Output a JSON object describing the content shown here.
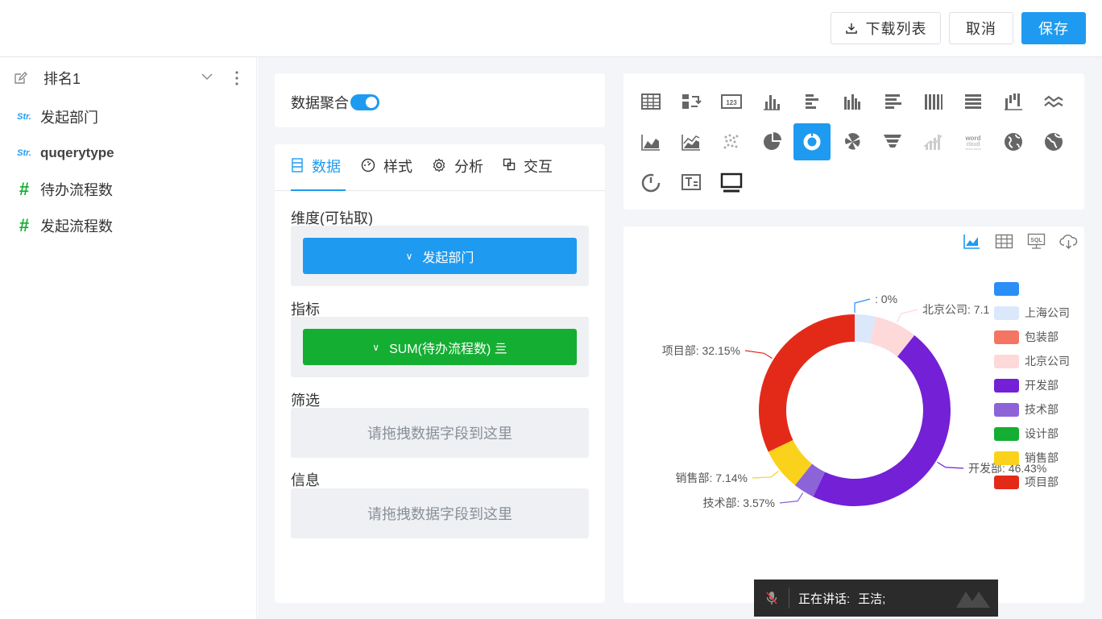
{
  "toolbar": {
    "download_label": "下载列表",
    "cancel_label": "取消",
    "save_label": "保存"
  },
  "sidebar": {
    "title": "排名1",
    "fields": [
      {
        "type": "Str.",
        "label": "发起部门"
      },
      {
        "type": "Str.",
        "label": "quqerytype"
      },
      {
        "type": "#",
        "label": "待办流程数"
      },
      {
        "type": "#",
        "label": "发起流程数"
      }
    ]
  },
  "aggregation": {
    "label": "数据聚合",
    "enabled": true
  },
  "tabs": [
    {
      "label": "数据",
      "icon": "data-icon"
    },
    {
      "label": "样式",
      "icon": "style-icon"
    },
    {
      "label": "分析",
      "icon": "gear-icon"
    },
    {
      "label": "交互",
      "icon": "interaction-icon"
    }
  ],
  "config": {
    "dimension_title": "维度(可钻取)",
    "dimension_value": "发起部门",
    "metric_title": "指标",
    "metric_value": "SUM(待办流程数) 亖",
    "filter_title": "筛选",
    "filter_placeholder": "请拖拽数据字段到这里",
    "info_title": "信息",
    "info_placeholder": "请拖拽数据字段到这里"
  },
  "chart_types": [
    "table",
    "pivot-table",
    "number-card",
    "column",
    "bar",
    "grouped-column",
    "stacked-bar",
    "percent-column",
    "percent-bar",
    "waterfall",
    "dual-line",
    "area",
    "stacked-area",
    "scatter",
    "pie",
    "donut",
    "rose",
    "funnel",
    "gradient-bar",
    "word-cloud",
    "map",
    "3d-map",
    "gauge",
    "text",
    "screen"
  ],
  "active_chart_type": "donut",
  "chart_tools": [
    "chart-icon",
    "table-icon",
    "sql-icon",
    "cloud-download-icon"
  ],
  "colors": {
    "accent": "#1e9bf0",
    "metric": "#14ae32"
  },
  "chart_data": {
    "type": "pie",
    "variant": "donut",
    "legend_position": "right",
    "legend": [
      {
        "name": "",
        "color": "#2a8ff7"
      },
      {
        "name": "上海公司",
        "color": "#dbe8fb"
      },
      {
        "name": "包装部",
        "color": "#f47562"
      },
      {
        "name": "北京公司",
        "color": "#fdd9d9"
      },
      {
        "name": "开发部",
        "color": "#7320d6"
      },
      {
        "name": "技术部",
        "color": "#8d63d8"
      },
      {
        "name": "设计部",
        "color": "#14ae32"
      },
      {
        "name": "销售部",
        "color": "#fad21c"
      },
      {
        "name": "项目部",
        "color": "#e32a19"
      }
    ],
    "slices": [
      {
        "name": "",
        "value": 0,
        "percent": 0,
        "color": "#2a8ff7"
      },
      {
        "name": "上海公司",
        "value": 3.57,
        "percent": 3.57,
        "color": "#dbe8fb"
      },
      {
        "name": "北京公司",
        "value": 7.14,
        "percent": 7.14,
        "color": "#fdd9d9"
      },
      {
        "name": "开发部",
        "value": 46.43,
        "percent": 46.43,
        "color": "#7320d6"
      },
      {
        "name": "技术部",
        "value": 3.57,
        "percent": 3.57,
        "color": "#8d63d8"
      },
      {
        "name": "销售部",
        "value": 7.14,
        "percent": 7.14,
        "color": "#fad21c"
      },
      {
        "name": "项目部",
        "value": 32.15,
        "percent": 32.15,
        "color": "#e32a19"
      }
    ],
    "labels": [
      ": 0%",
      "北京公司: 7.1",
      "项目部: 32.15%",
      "开发部: 46.43%",
      "销售部: 7.14%",
      "技术部: 3.57%"
    ]
  },
  "speaking": {
    "label": "正在讲话:",
    "name": "王洁;"
  }
}
